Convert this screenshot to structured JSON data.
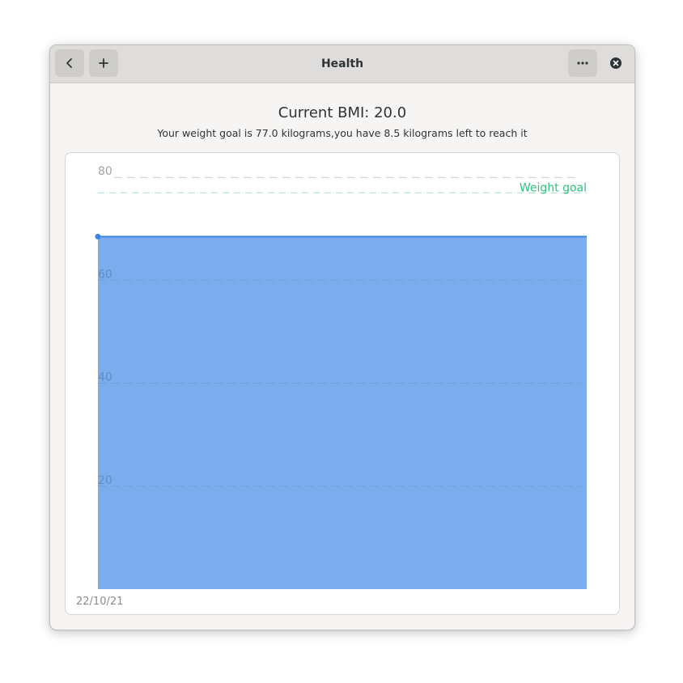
{
  "window": {
    "title": "Health",
    "buttons": {
      "back_icon": "chevron-left",
      "add_icon": "plus",
      "menu_icon": "ellipsis",
      "close_icon": "close-circle"
    }
  },
  "summary": {
    "bmi_text": "Current BMI: 20.0",
    "goal_text": "Your weight goal is 77.0 kilograms,you have 8.5 kilograms left to reach it"
  },
  "chart_data": {
    "type": "area",
    "x": [
      "22/10/21"
    ],
    "series": [
      {
        "values": [
          68.5
        ]
      }
    ],
    "y_ticks": [
      20,
      40,
      60,
      80
    ],
    "ylim": [
      0,
      80
    ],
    "grid": true,
    "goal": {
      "label": "Weight goal",
      "value": 77.0
    },
    "colors": {
      "area": "#7badee",
      "line": "#3d86e0",
      "goal": "#2ec27e",
      "grid": "#c8c8c8",
      "tick": "#a3a3a1"
    }
  }
}
